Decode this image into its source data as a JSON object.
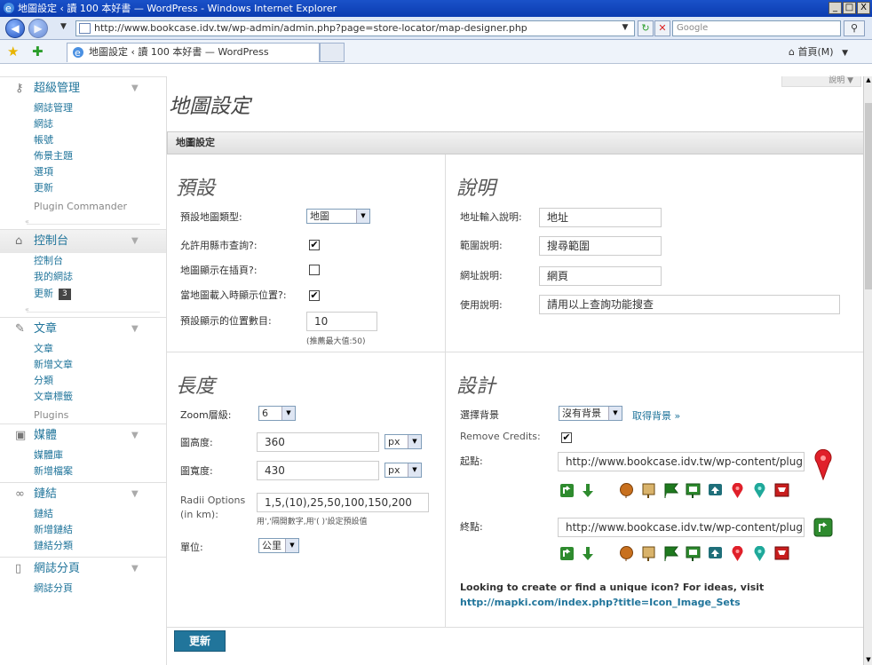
{
  "window": {
    "title": "地圖設定 ‹ 讀 100 本好書 — WordPress - Windows Internet Explorer",
    "min": "_",
    "max": "□",
    "close": "X"
  },
  "browser": {
    "url": "http://www.bookcase.idv.tw/wp-admin/admin.php?page=store-locator/map-designer.php",
    "search_placeholder": "Google",
    "tab_title": "地圖設定 ‹ 讀 100 本好書 — WordPress",
    "home_label": "首頁(M)"
  },
  "sidebar": {
    "super_admin": {
      "label": "超級管理",
      "items": [
        "網誌管理",
        "網誌",
        "帳號",
        "佈景主題",
        "選項",
        "更新"
      ],
      "plugin_item": "Plugin Commander"
    },
    "dashboard": {
      "label": "控制台",
      "items": [
        "控制台",
        "我的網誌"
      ],
      "update_label": "更新",
      "update_count": "3"
    },
    "posts": {
      "label": "文章",
      "items": [
        "文章",
        "新增文章",
        "分類",
        "文章標籤"
      ],
      "plugins_item": "Plugins"
    },
    "media": {
      "label": "媒體",
      "items": [
        "媒體庫",
        "新增檔案"
      ]
    },
    "links": {
      "label": "鏈結",
      "items": [
        "鏈結",
        "新增鏈結",
        "鏈結分類"
      ]
    },
    "pages": {
      "label": "網誌分頁",
      "items": [
        "網誌分頁"
      ]
    }
  },
  "header": {
    "help": "說明",
    "page_title": "地圖設定",
    "box_title": "地圖設定"
  },
  "defaults": {
    "title": "預設",
    "map_type_label": "預設地圖類型:",
    "map_type_value": "地圖",
    "city_search_label": "允許用縣市查詢?:",
    "city_search_checked": true,
    "show_in_page_label": "地圖顯示在插頁?:",
    "show_in_page_checked": false,
    "show_location_label": "當地圖載入時顯示位置?:",
    "show_location_checked": true,
    "count_label": "預設顯示的位置數目:",
    "count_value": "10",
    "count_hint": "(推薦最大值:50)"
  },
  "description": {
    "title": "說明",
    "address_label": "地址輸入說明:",
    "address_value": "地址",
    "range_label": "範圍說明:",
    "range_value": "搜尋範圍",
    "website_label": "網址說明:",
    "website_value": "網頁",
    "usage_label": "使用說明:",
    "usage_value": "請用以上查詢功能搜查"
  },
  "dimensions": {
    "title": "長度",
    "zoom_label": "Zoom層級:",
    "zoom_value": "6",
    "height_label": "圖高度:",
    "height_value": "360",
    "height_unit": "px",
    "width_label": "圖寬度:",
    "width_value": "430",
    "width_unit": "px",
    "radii_label_1": "Radii Options",
    "radii_label_2": "(in km):",
    "radii_value": "1,5,(10),25,50,100,150,200",
    "radii_hint": "用','隔開數字,用'( )'設定預設值",
    "unit_label": "單位:",
    "unit_value": "公里"
  },
  "design": {
    "title": "設計",
    "bg_label": "選擇背景",
    "bg_value": "沒有背景",
    "bg_link": "取得背景 »",
    "credits_label": "Remove Credits:",
    "credits_checked": true,
    "start_label": "起點:",
    "start_value": "http://www.bookcase.idv.tw/wp-content/plug",
    "end_label": "終點:",
    "end_value": "http://www.bookcase.idv.tw/wp-content/plug",
    "icon_note": "Looking to create or find a unique icon? For ideas, visit",
    "icon_link": "http://mapki.com/index.php?title=Icon_Image_Sets"
  },
  "save_label": "更新",
  "colors": {
    "admin_blue": "#21759b",
    "marker_red": "#e0202a",
    "icon_green": "#2e8b2e"
  }
}
